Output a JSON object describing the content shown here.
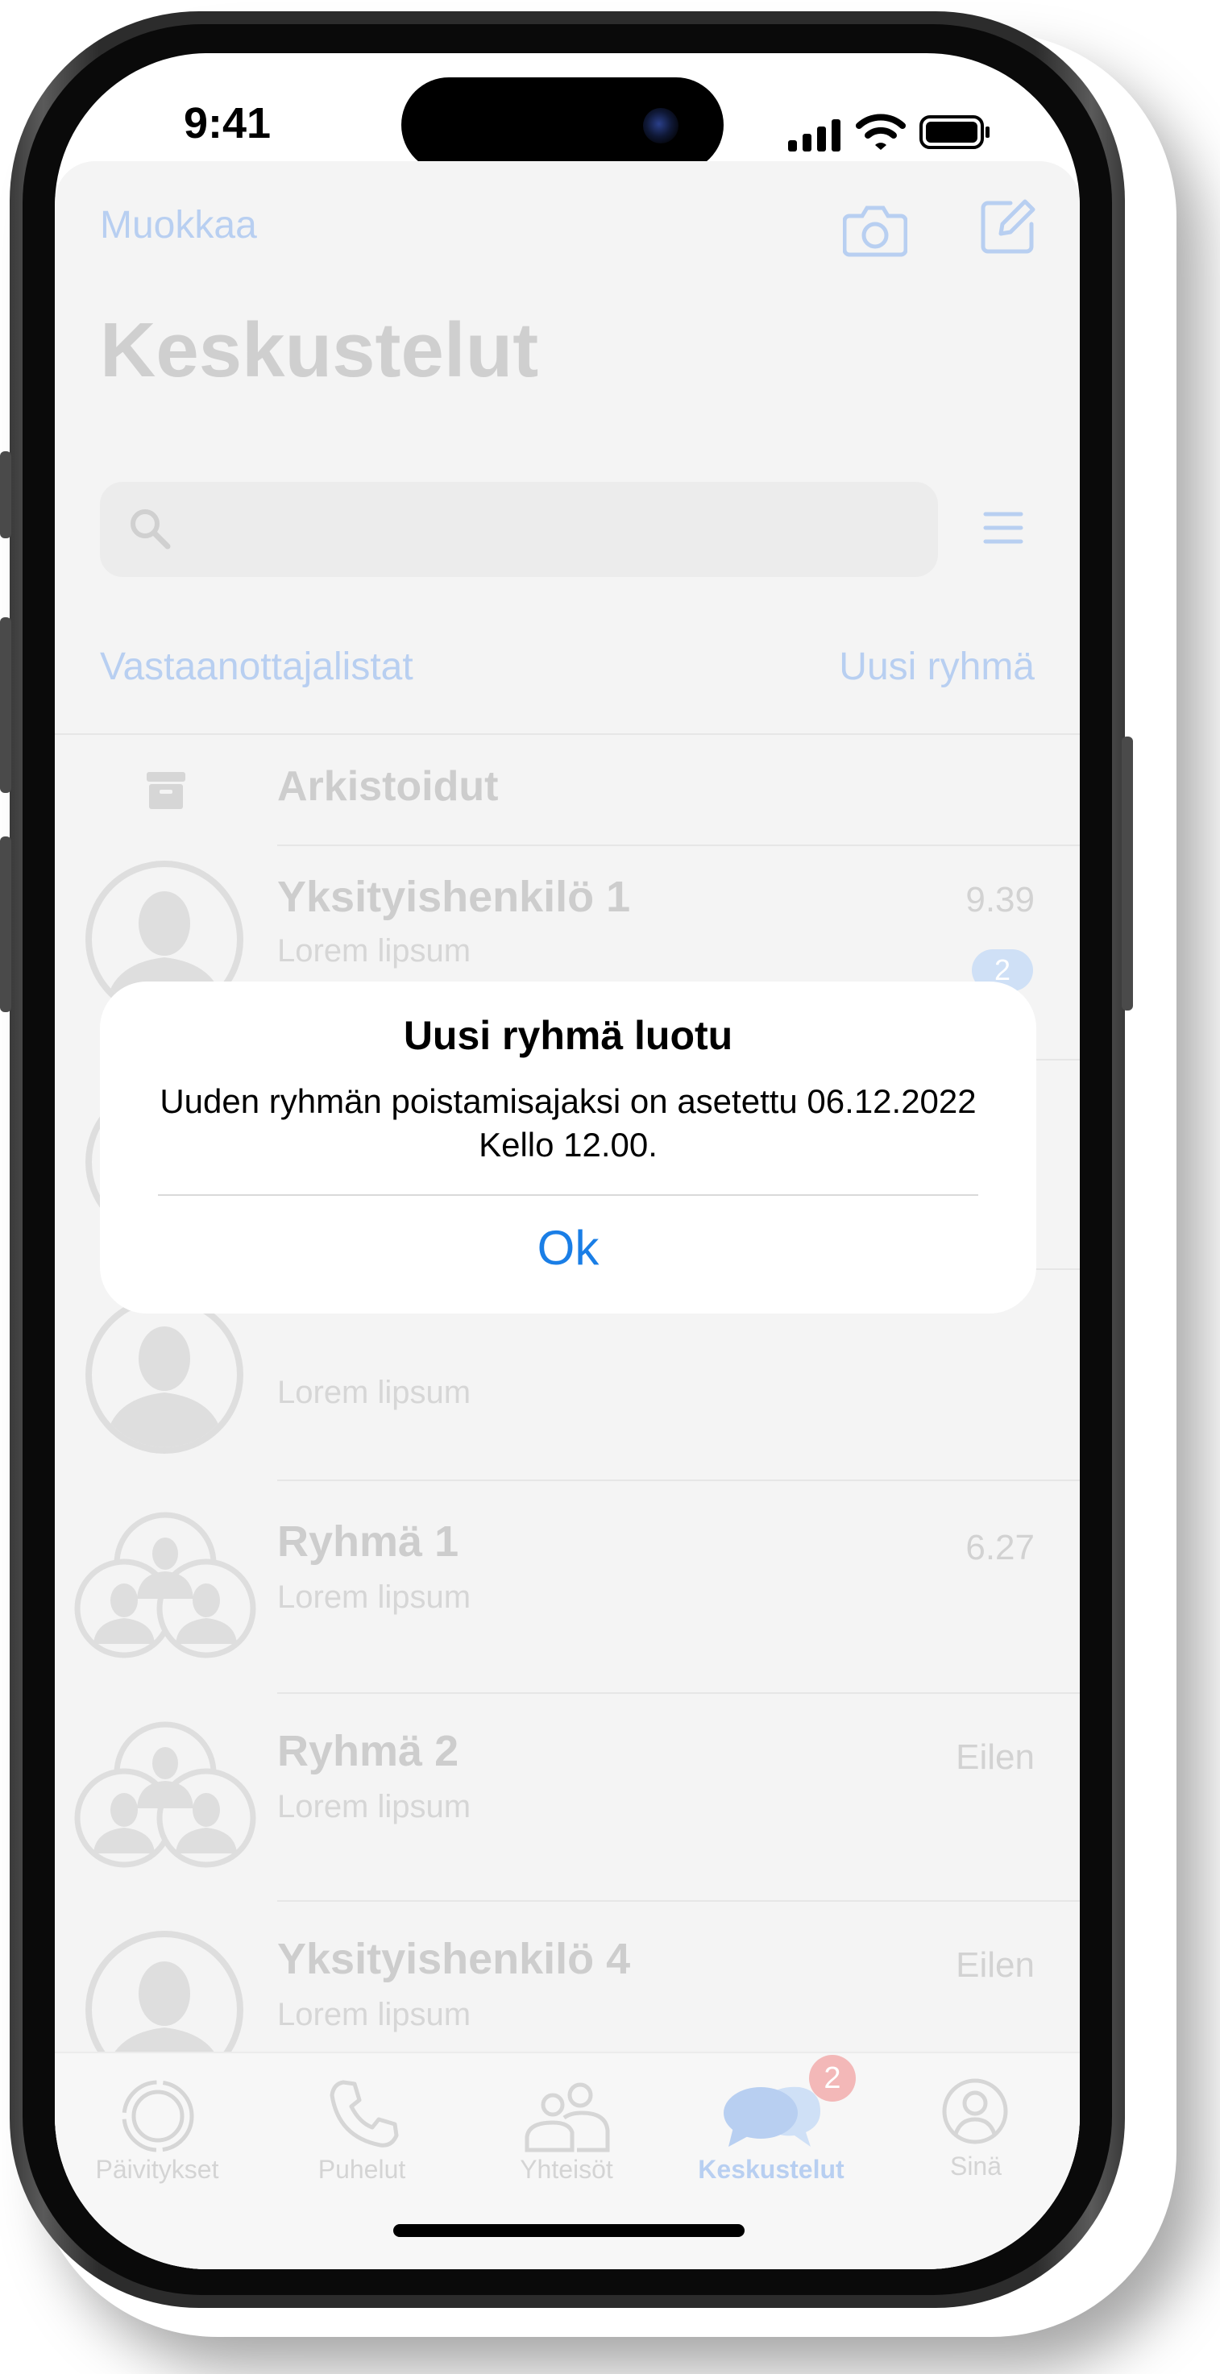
{
  "status_bar": {
    "time": "9:41"
  },
  "header": {
    "edit_label": "Muokkaa",
    "camera_icon": "camera-icon",
    "compose_icon": "compose-icon",
    "title": "Keskustelut"
  },
  "search": {
    "icon": "search-icon",
    "filter_icon": "filter-icon"
  },
  "links": {
    "broadcast_lists": "Vastaanottajalistat",
    "new_group": "Uusi ryhmä"
  },
  "archived": {
    "label": "Arkistoidut",
    "icon": "archive-icon"
  },
  "chats": [
    {
      "name": "Yksityishenkilö 1",
      "preview": "Lorem lipsum",
      "time": "9.39",
      "unread": "2",
      "avatar": "person-avatar-icon"
    },
    {
      "name": "",
      "preview": "",
      "time": "",
      "avatar": "person-avatar-icon"
    },
    {
      "name": "",
      "preview": "Lorem lipsum",
      "time": "",
      "avatar": "person-avatar-icon"
    },
    {
      "name": "Ryhmä 1",
      "preview": "Lorem lipsum",
      "time": "6.27",
      "avatar": "group-avatar-icon"
    },
    {
      "name": "Ryhmä 2",
      "preview": "Lorem lipsum",
      "time": "Eilen",
      "avatar": "group-avatar-icon"
    },
    {
      "name": "Yksityishenkilö 4",
      "preview": "Lorem lipsum",
      "time": "Eilen",
      "avatar": "person-avatar-icon"
    }
  ],
  "tabbar": {
    "items": [
      {
        "label": "Päivitykset",
        "icon": "updates-icon"
      },
      {
        "label": "Puhelut",
        "icon": "phone-icon"
      },
      {
        "label": "Yhteisöt",
        "icon": "communities-icon"
      },
      {
        "label": "Keskustelut",
        "icon": "chats-icon",
        "active": true,
        "badge": "2"
      },
      {
        "label": "Sinä",
        "icon": "profile-icon"
      }
    ]
  },
  "alert": {
    "title": "Uusi ryhmä luotu",
    "message": "Uuden ryhmän poistamisajaksi on asetettu 06.12.2022 Kello 12.00.",
    "ok_label": "Ok"
  },
  "colors": {
    "accent": "#1a7ee6",
    "dimmed_accent": "#b8cff1",
    "badge": "#f0a0a0"
  }
}
